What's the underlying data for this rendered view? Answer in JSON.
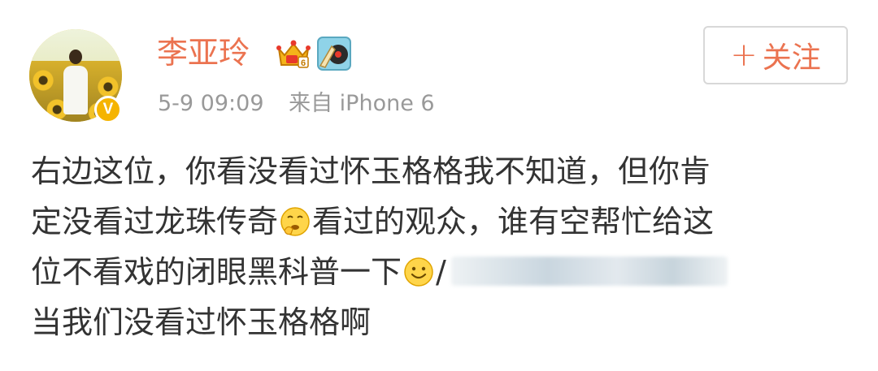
{
  "post": {
    "author": "李亚玲",
    "time": "5-9 09:09",
    "source": "来自 iPhone 6",
    "follow_plus": "+",
    "follow_label": "关注",
    "verified_mark": "V",
    "content": {
      "line1": "右边这位，你看没看过怀玉格格我不知道，但你肯",
      "line2a": "定没看过龙珠传奇",
      "line2b": "看过的观众，谁有空帮忙给这",
      "line3a": "位不看戏的闭眼黑科普一下",
      "line3b": "/",
      "line4": "当我们没看过怀玉格格啊"
    }
  },
  "icons": {
    "vip": "crown-vip-icon",
    "music": "music-badge-icon",
    "emoji1": "thinking-emoji-icon",
    "emoji2": "smile-emoji-icon"
  },
  "colors": {
    "author": "#eb7350",
    "meta": "#999999",
    "text": "#333333",
    "verified": "#f5b400"
  }
}
